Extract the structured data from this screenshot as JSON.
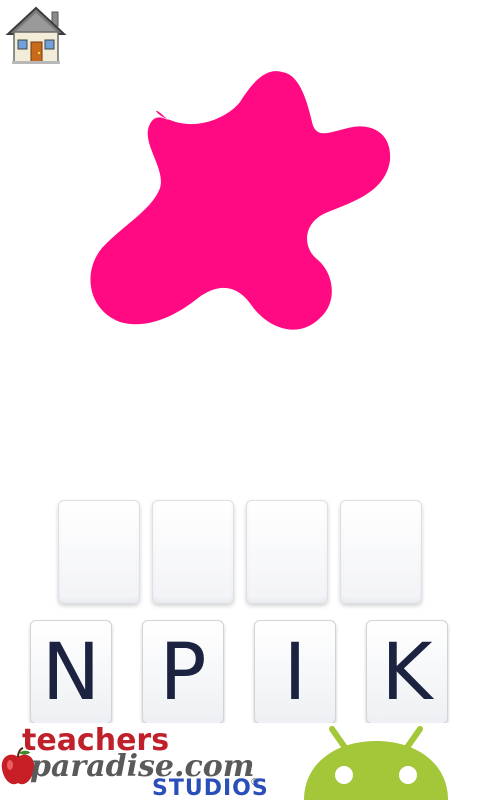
{
  "colors": {
    "blob": "#ff0a82",
    "tile_letter": "#1b2340",
    "ad_red": "#c0202a",
    "ad_blue": "#2a4fb8",
    "android_green": "#a4c639"
  },
  "home_button": {
    "icon": "house-icon"
  },
  "answer_slots": [
    {
      "letter": ""
    },
    {
      "letter": ""
    },
    {
      "letter": ""
    },
    {
      "letter": ""
    }
  ],
  "letter_tiles": [
    {
      "letter": "N"
    },
    {
      "letter": "P"
    },
    {
      "letter": "I"
    },
    {
      "letter": "K"
    }
  ],
  "ad": {
    "line1": "teachers",
    "line2": "paradise.com",
    "registered": "®",
    "line3": "STUDIOS",
    "mascot": "android-robot-icon"
  }
}
